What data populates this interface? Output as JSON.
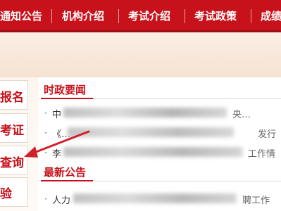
{
  "nav": {
    "items": [
      "通知公告",
      "机构介绍",
      "考试介绍",
      "考试政策",
      "成绩"
    ]
  },
  "sidebar": {
    "items": [
      "报名",
      "考证",
      "查询",
      "验"
    ]
  },
  "sections": {
    "news_title": "时政要闻",
    "notices_title": "最新公告"
  },
  "news": [
    {
      "prefix": "中",
      "suffix": "央…"
    },
    {
      "prefix": "《…",
      "suffix": "发行"
    },
    {
      "prefix": "李",
      "suffix": "工作情"
    }
  ],
  "notices": [
    {
      "prefix": "人力",
      "suffix": "聘工作"
    }
  ],
  "colors": {
    "brand_red": "#c8121b",
    "arrow": "#d0202a"
  }
}
